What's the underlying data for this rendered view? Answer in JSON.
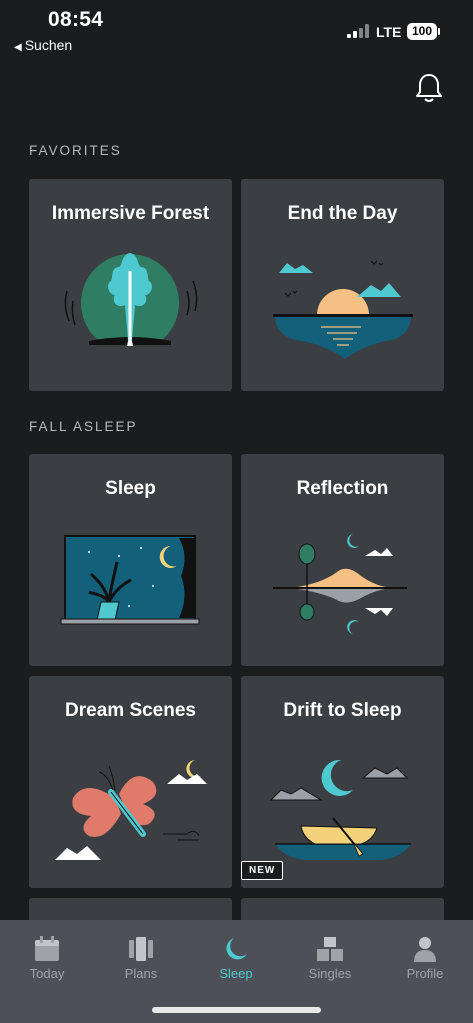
{
  "status_bar": {
    "time": "08:54",
    "back_label": "Suchen",
    "network": "LTE",
    "battery": "100"
  },
  "header": {
    "bell_icon": "bell-icon"
  },
  "sections": [
    {
      "title": "FAVORITES",
      "cards": [
        {
          "title": "Immersive Forest"
        },
        {
          "title": "End the Day"
        }
      ]
    },
    {
      "title": "FALL ASLEEP",
      "cards": [
        {
          "title": "Sleep"
        },
        {
          "title": "Reflection"
        },
        {
          "title": "Dream Scenes"
        },
        {
          "title": "Drift to Sleep",
          "badge": "NEW"
        }
      ]
    }
  ],
  "tabs": [
    {
      "label": "Today",
      "icon": "calendar-icon",
      "active": false
    },
    {
      "label": "Plans",
      "icon": "plans-icon",
      "active": false
    },
    {
      "label": "Sleep",
      "icon": "moon-icon",
      "active": true
    },
    {
      "label": "Singles",
      "icon": "blocks-icon",
      "active": false
    },
    {
      "label": "Profile",
      "icon": "person-icon",
      "active": false
    }
  ],
  "colors": {
    "accent": "#4ec9d0",
    "card": "#3b3e43",
    "background": "#1b1c1e",
    "tab_bar": "#4d5157"
  }
}
